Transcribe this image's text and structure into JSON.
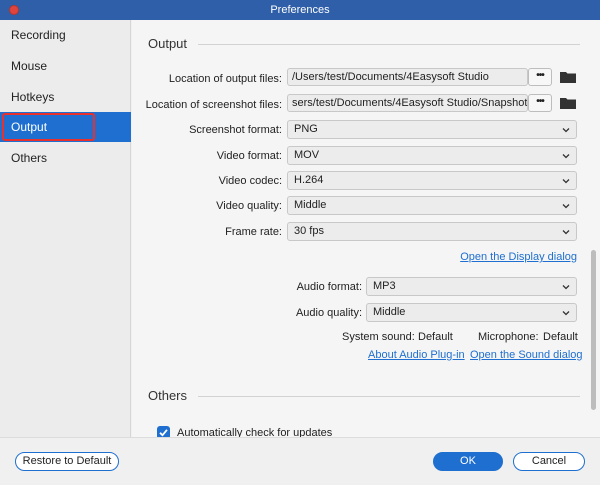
{
  "window": {
    "title": "Preferences"
  },
  "sidebar": {
    "items": [
      {
        "label": "Recording"
      },
      {
        "label": "Mouse"
      },
      {
        "label": "Hotkeys"
      },
      {
        "label": "Output"
      },
      {
        "label": "Others"
      }
    ],
    "selected": "Output"
  },
  "output": {
    "section_title": "Output",
    "output_files": {
      "label": "Location of output files:",
      "value": "/Users/test/Documents/4Easysoft Studio"
    },
    "screenshot_files": {
      "label": "Location of screenshot files:",
      "value": "sers/test/Documents/4Easysoft Studio/Snapshot"
    },
    "browse_label": "•••",
    "screenshot_format": {
      "label": "Screenshot format:",
      "value": "PNG"
    },
    "video_format": {
      "label": "Video format:",
      "value": "MOV"
    },
    "video_codec": {
      "label": "Video codec:",
      "value": "H.264"
    },
    "video_quality": {
      "label": "Video quality:",
      "value": "Middle"
    },
    "frame_rate": {
      "label": "Frame rate:",
      "value": "30 fps"
    },
    "display_dialog_link": "Open the Display dialog",
    "audio_format": {
      "label": "Audio format:",
      "value": "MP3"
    },
    "audio_quality": {
      "label": "Audio quality:",
      "value": "Middle"
    },
    "system_sound": {
      "label": "System sound:",
      "value": "Default"
    },
    "microphone": {
      "label": "Microphone:",
      "value": "Default"
    },
    "audio_plugin_link": "About Audio Plug-in",
    "sound_dialog_link": "Open the Sound dialog"
  },
  "others": {
    "section_title": "Others",
    "auto_update": {
      "label": "Automatically check for updates",
      "checked": true
    }
  },
  "footer": {
    "restore_label": "Restore to Default",
    "ok_label": "OK",
    "cancel_label": "Cancel"
  },
  "colors": {
    "accent": "#1e6fd0",
    "highlight": "#e8312c",
    "titlebar": "#2f5fa8"
  }
}
